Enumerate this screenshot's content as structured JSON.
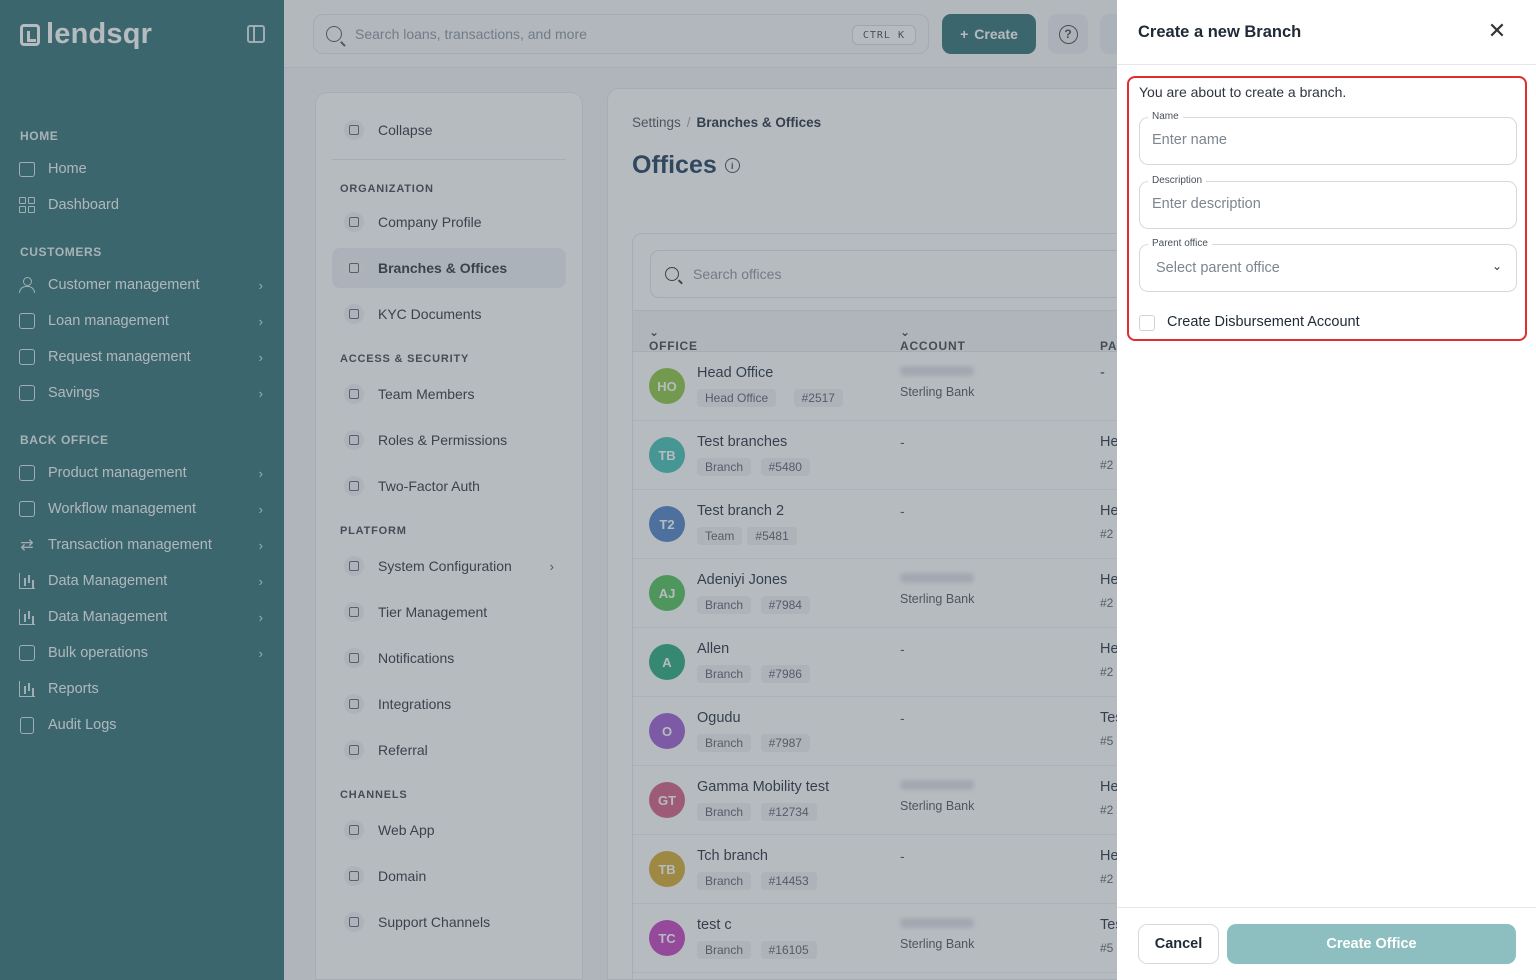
{
  "brand": {
    "name": "lendsqr"
  },
  "sidebar": {
    "sections": [
      {
        "title": "HOME",
        "items": [
          {
            "label": "Home",
            "icon": "home-icon",
            "chevron": false
          },
          {
            "label": "Dashboard",
            "icon": "dashboard-icon",
            "chevron": false
          }
        ]
      },
      {
        "title": "CUSTOMERS",
        "items": [
          {
            "label": "Customer management",
            "icon": "users-icon",
            "chevron": true
          },
          {
            "label": "Loan management",
            "icon": "loan-icon",
            "chevron": true
          },
          {
            "label": "Request management",
            "icon": "inbox-icon",
            "chevron": true
          },
          {
            "label": "Savings",
            "icon": "savings-icon",
            "chevron": true
          }
        ]
      },
      {
        "title": "BACK OFFICE",
        "items": [
          {
            "label": "Product management",
            "icon": "package-icon",
            "chevron": true
          },
          {
            "label": "Workflow management",
            "icon": "workflow-icon",
            "chevron": true
          },
          {
            "label": "Transaction management",
            "icon": "swap-icon",
            "chevron": true
          },
          {
            "label": "Data Management",
            "icon": "chart-icon",
            "chevron": true
          },
          {
            "label": "Data Management",
            "icon": "chart-icon",
            "chevron": true
          },
          {
            "label": "Bulk operations",
            "icon": "inbox-icon",
            "chevron": true
          },
          {
            "label": "Reports",
            "icon": "chart-icon",
            "chevron": false
          },
          {
            "label": "Audit Logs",
            "icon": "clipboard-icon",
            "chevron": false
          }
        ]
      }
    ]
  },
  "topbar": {
    "search_placeholder": "Search loans, transactions, and more",
    "shortcut": "CTRL K",
    "create_label": "Create",
    "help_symbol": "?"
  },
  "settings_menu": {
    "collapse_label": "Collapse",
    "sections": [
      {
        "title": "ORGANIZATION",
        "items": [
          {
            "label": "Company Profile",
            "active": false
          },
          {
            "label": "Branches & Offices",
            "active": true
          },
          {
            "label": "KYC Documents",
            "active": false
          }
        ]
      },
      {
        "title": "ACCESS & SECURITY",
        "items": [
          {
            "label": "Team Members",
            "active": false
          },
          {
            "label": "Roles & Permissions",
            "active": false
          },
          {
            "label": "Two-Factor Auth",
            "active": false
          }
        ]
      },
      {
        "title": "PLATFORM",
        "items": [
          {
            "label": "System Configuration",
            "active": false,
            "chevron": true
          },
          {
            "label": "Tier Management",
            "active": false
          },
          {
            "label": "Notifications",
            "active": false
          },
          {
            "label": "Integrations",
            "active": false
          },
          {
            "label": "Referral",
            "active": false
          }
        ]
      },
      {
        "title": "CHANNELS",
        "items": [
          {
            "label": "Web App",
            "active": false
          },
          {
            "label": "Domain",
            "active": false
          },
          {
            "label": "Support Channels",
            "active": false
          }
        ]
      }
    ]
  },
  "main": {
    "breadcrumb": {
      "root": "Settings",
      "separator": "/",
      "current": "Branches & Offices"
    },
    "title": "Offices",
    "table_search_placeholder": "Search offices",
    "columns": [
      "OFFICE",
      "ACCOUNT",
      "PA"
    ],
    "rows": [
      {
        "initials": "HO",
        "color": "#8cc43c",
        "name": "Head Office",
        "type": "Head Office",
        "code": "#2517",
        "account_masked": true,
        "bank": "Sterling Bank",
        "parent": "-",
        "parent_sub": ""
      },
      {
        "initials": "TB",
        "color": "#3fbfb2",
        "name": "Test branches",
        "type": "Branch",
        "code": "#5480",
        "account_masked": false,
        "bank": "",
        "parent": "He",
        "parent_sub": "#2"
      },
      {
        "initials": "T2",
        "color": "#4d7fc4",
        "name": "Test branch 2",
        "type": "Team",
        "code": "#5481",
        "account_masked": false,
        "bank": "",
        "parent": "He",
        "parent_sub": "#2"
      },
      {
        "initials": "AJ",
        "color": "#4cbf54",
        "name": "Adeniyi Jones",
        "type": "Branch",
        "code": "#7984",
        "account_masked": true,
        "bank": "Sterling Bank",
        "parent": "He",
        "parent_sub": "#2"
      },
      {
        "initials": "A",
        "color": "#23a878",
        "name": "Allen",
        "type": "Branch",
        "code": "#7986",
        "account_masked": false,
        "bank": "",
        "parent": "He",
        "parent_sub": "#2"
      },
      {
        "initials": "O",
        "color": "#9b59d0",
        "name": "Ogudu",
        "type": "Branch",
        "code": "#7987",
        "account_masked": false,
        "bank": "",
        "parent": "Tes",
        "parent_sub": "#5"
      },
      {
        "initials": "GT",
        "color": "#d65a82",
        "name": "Gamma Mobility test",
        "type": "Branch",
        "code": "#12734",
        "account_masked": true,
        "bank": "Sterling Bank",
        "parent": "He",
        "parent_sub": "#2"
      },
      {
        "initials": "TB",
        "color": "#d4a82a",
        "name": "Tch branch",
        "type": "Branch",
        "code": "#14453",
        "account_masked": false,
        "bank": "",
        "parent": "He",
        "parent_sub": "#2"
      },
      {
        "initials": "TC",
        "color": "#c43cbf",
        "name": "test c",
        "type": "Branch",
        "code": "#16105",
        "account_masked": true,
        "bank": "Sterling Bank",
        "parent": "Tes",
        "parent_sub": "#5"
      }
    ]
  },
  "drawer": {
    "title": "Create a new Branch",
    "intro": "You are about to create a branch.",
    "name_label": "Name",
    "name_placeholder": "Enter name",
    "description_label": "Description",
    "description_placeholder": "Enter description",
    "parent_label": "Parent office",
    "parent_placeholder": "Select parent office",
    "checkbox_label": "Create Disbursement Account",
    "cancel_label": "Cancel",
    "submit_label": "Create Office",
    "highlight_color": "#e02d2d"
  }
}
